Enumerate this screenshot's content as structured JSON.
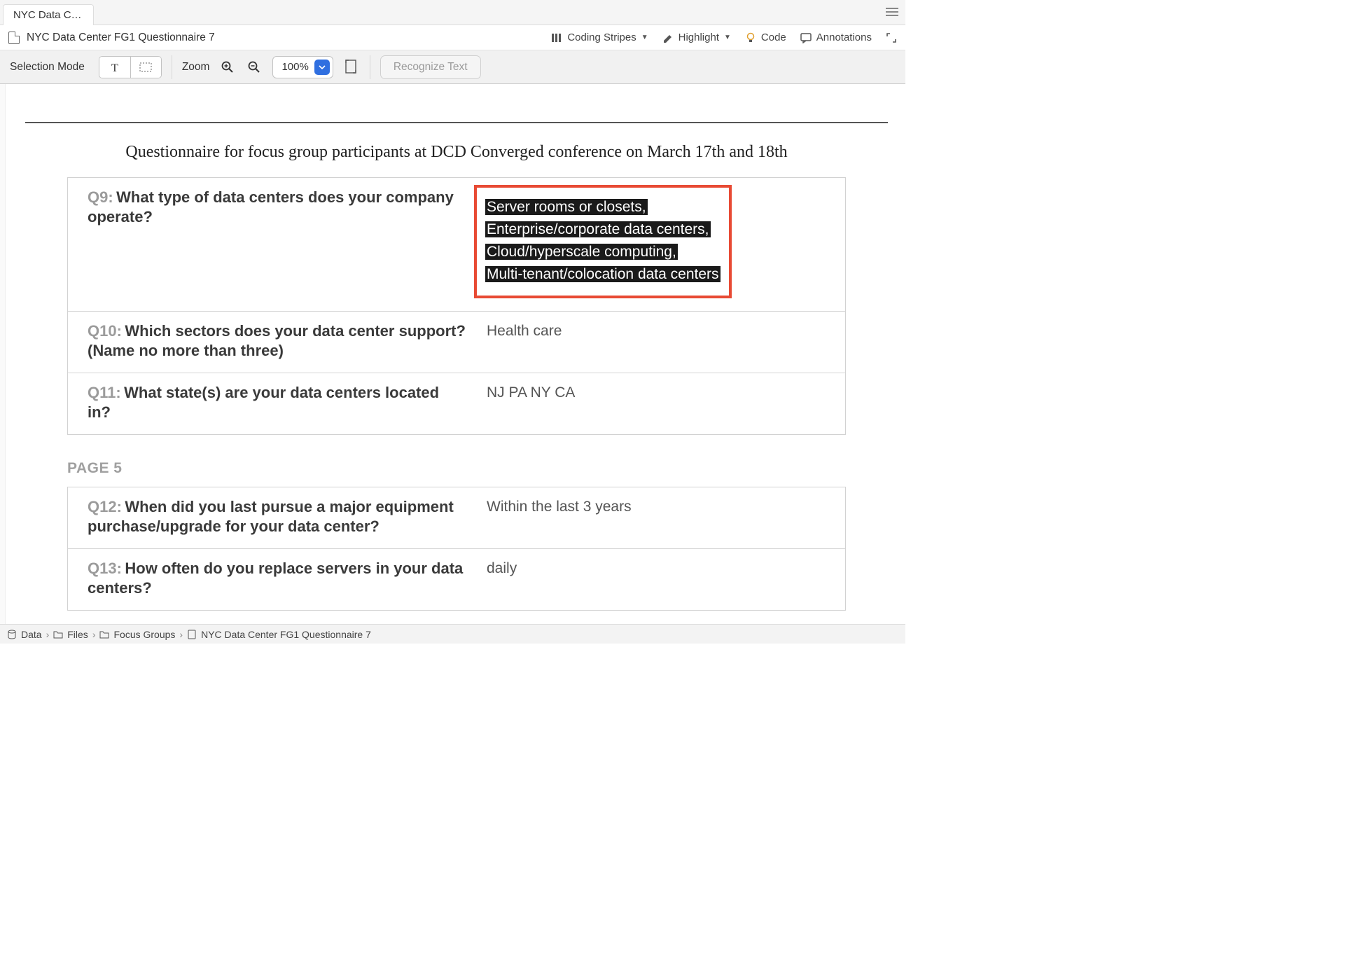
{
  "tab": {
    "title": "NYC Data Ce..."
  },
  "document": {
    "title": "NYC Data Center FG1 Questionnaire 7",
    "heading": "Questionnaire for focus group participants at DCD Converged conference on March 17th and 18th"
  },
  "tools": {
    "coding_stripes": "Coding Stripes",
    "highlight": "Highlight",
    "code": "Code",
    "annotations": "Annotations"
  },
  "toolbar": {
    "selection_mode": "Selection Mode",
    "zoom_label": "Zoom",
    "zoom_value": "100%",
    "recognize": "Recognize Text"
  },
  "page4": {
    "q9": {
      "label": "Q9:",
      "text": "What type of data centers does your company operate?",
      "answers": [
        "Server rooms or closets,",
        "Enterprise/corporate data centers,",
        "Cloud/hyperscale computing,",
        "Multi-tenant/colocation data centers"
      ]
    },
    "q10": {
      "label": "Q10:",
      "text": "Which sectors does your data center support? (Name no more than three)",
      "answer": "Health care"
    },
    "q11": {
      "label": "Q11:",
      "text": "What state(s) are your data centers located in?",
      "answer": "NJ PA NY CA"
    }
  },
  "page5_label": "PAGE 5",
  "page5": {
    "q12": {
      "label": "Q12:",
      "text": "When did you last pursue a major equipment purchase/upgrade for your data center?",
      "answer": "Within the last 3 years"
    },
    "q13": {
      "label": "Q13:",
      "text": "How often do you replace servers in your data centers?",
      "answer": "daily"
    }
  },
  "breadcrumb": {
    "root": "Data",
    "files": "Files",
    "folder": "Focus Groups",
    "file": "NYC Data Center FG1 Questionnaire 7"
  }
}
